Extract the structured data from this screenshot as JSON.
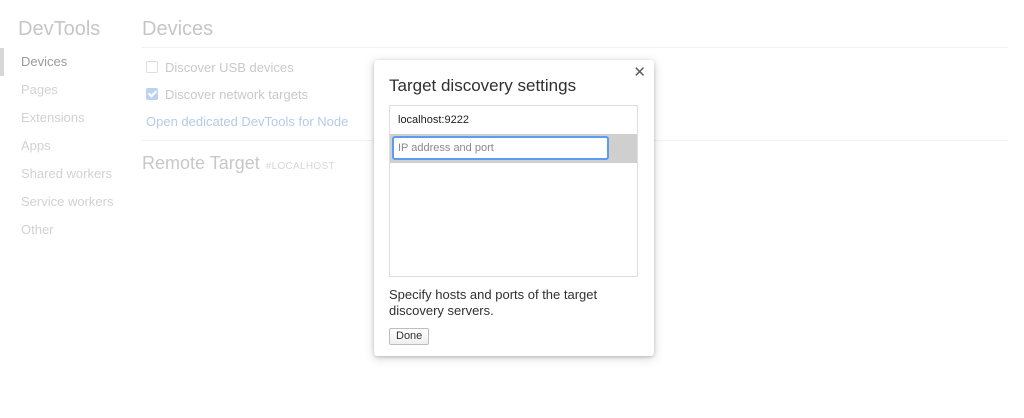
{
  "app": {
    "brand": "DevTools"
  },
  "sidebar": {
    "items": [
      {
        "label": "Devices",
        "active": true
      },
      {
        "label": "Pages",
        "active": false
      },
      {
        "label": "Extensions",
        "active": false
      },
      {
        "label": "Apps",
        "active": false
      },
      {
        "label": "Shared workers",
        "active": false
      },
      {
        "label": "Service workers",
        "active": false
      },
      {
        "label": "Other",
        "active": false
      }
    ]
  },
  "main": {
    "title": "Devices",
    "options": [
      {
        "label": "Discover USB devices",
        "checked": false
      },
      {
        "label": "Discover network targets",
        "checked": true
      }
    ],
    "node_link": "Open dedicated DevTools for Node",
    "remote_target": {
      "title": "Remote Target",
      "tag": "#LOCALHOST"
    }
  },
  "dialog": {
    "title": "Target discovery settings",
    "close_icon": "close-icon",
    "entries": [
      "localhost:9222"
    ],
    "input": {
      "value": "",
      "placeholder": "IP address and port"
    },
    "description": "Specify hosts and ports of the target discovery servers.",
    "done_label": "Done"
  },
  "colors": {
    "input_focus": "#5b9cf3",
    "edit_row_bg": "#cfcfcf",
    "link": "#b5cbea"
  }
}
